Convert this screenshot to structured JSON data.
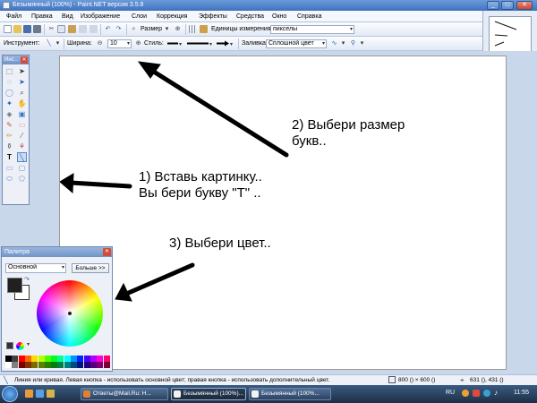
{
  "window": {
    "title": "Безымянный (100%) - Paint.NET версия 3.5.8",
    "minimize": "_",
    "maximize": "□",
    "close": "✕"
  },
  "menu": [
    "Файл",
    "Правка",
    "Вид",
    "Изображение",
    "Слои",
    "Коррекция",
    "Эффекты",
    "Средства",
    "Окно",
    "Справка"
  ],
  "toolbar1": {
    "zoom_label": "Размер",
    "units_label": "Единицы измерения:",
    "units_value": "пикселы"
  },
  "toolbar2": {
    "tool_label": "Инструмент:",
    "width_label": "Ширина:",
    "width_value": "10",
    "style_label": "Стиль:",
    "fill_label": "Заливка:",
    "fill_value": "Сплошной цвет"
  },
  "tools_panel": {
    "title": "Инс...",
    "close": "✕"
  },
  "palette": {
    "title": "Палитра",
    "close": "✕",
    "mode_value": "Основной",
    "more_button": "Больше >>",
    "primary_color": "#202020",
    "secondary_color": "#ffffff",
    "swatches_row1": [
      "#000000",
      "#404040",
      "#ff0000",
      "#ff6a00",
      "#ffd800",
      "#b6ff00",
      "#4cff00",
      "#00ff21",
      "#00ff90",
      "#00ffff",
      "#0094ff",
      "#0026ff",
      "#4800ff",
      "#b200ff",
      "#ff00dc",
      "#ff006e"
    ],
    "swatches_row2": [
      "#ffffff",
      "#808080",
      "#7f0000",
      "#7f3300",
      "#7f6a00",
      "#5b7f00",
      "#267f00",
      "#007f0e",
      "#007f46",
      "#007f7f",
      "#004a7f",
      "#00137f",
      "#21007f",
      "#57007f",
      "#7f006e",
      "#7f0037"
    ]
  },
  "annotations": {
    "size": [
      "2) Выбери размер",
      "букв.."
    ],
    "text_tool": [
      "1) Вставь картинку..",
      "Вы бери букву \"T\" .."
    ],
    "color": "3) Выбери цвет.."
  },
  "status": {
    "hint": "Линия или кривая. Левая кнопка - использовать основной цвет; правая кнопка - использовать дополнительный цвет.",
    "size": "800 () × 600 ()",
    "coords": "631 (), 431 ()"
  },
  "taskbar": {
    "tasks": [
      "Ответы@Mail.Ru: Н...",
      "Безымянный (100%)...",
      "Безымянный (100%..."
    ],
    "lang": "RU",
    "clock": "11:55"
  },
  "icons": {
    "tool_active": "text-tool-icon"
  }
}
